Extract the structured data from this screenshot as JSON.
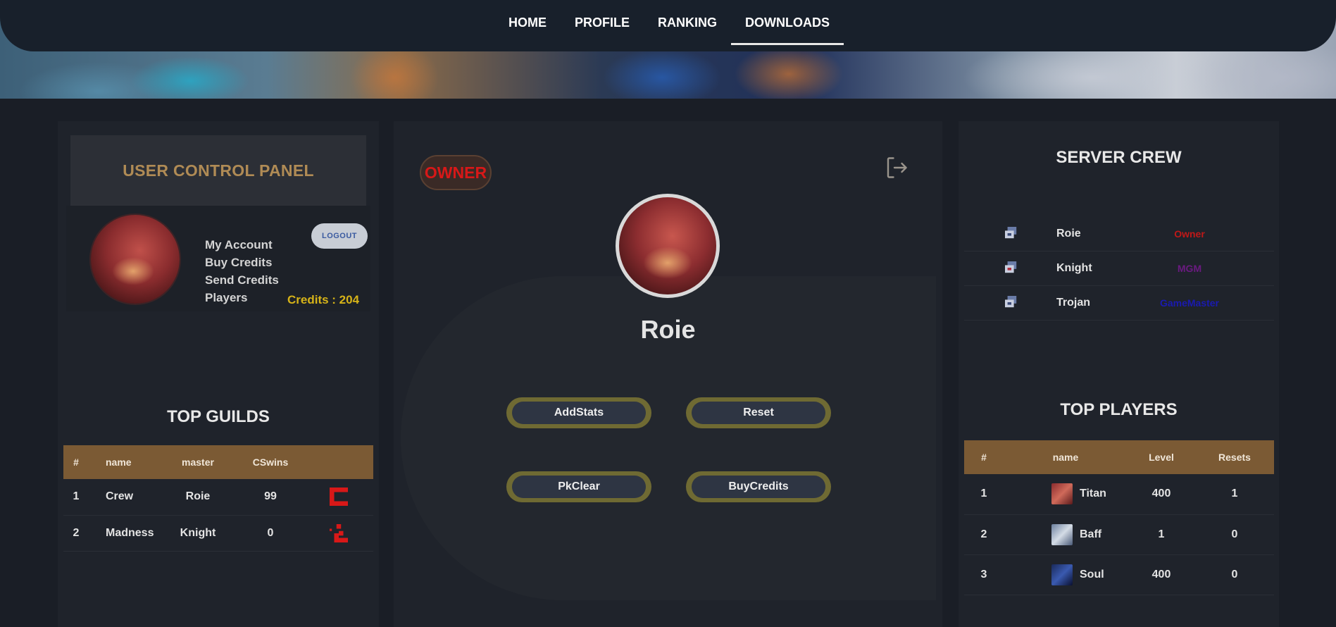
{
  "nav": {
    "items": [
      {
        "label": "HOME",
        "active": false
      },
      {
        "label": "PROFILE",
        "active": false
      },
      {
        "label": "RANKING",
        "active": false
      },
      {
        "label": "DOWNLOADS",
        "active": true
      }
    ]
  },
  "ucp": {
    "title": "USER CONTROL PANEL",
    "links": [
      "My Account",
      "Buy Credits",
      "Send Credits",
      "Players"
    ],
    "logout_label": "LOGOUT",
    "credits": "Credits : 204"
  },
  "guilds": {
    "title": "TOP GUILDS",
    "columns": [
      "#",
      "name",
      "master",
      "CSwins",
      ""
    ],
    "rows": [
      {
        "rank": "1",
        "name": "Crew",
        "master": "Roie",
        "cswins": "99"
      },
      {
        "rank": "2",
        "name": "Madness",
        "master": "Knight",
        "cswins": "0"
      }
    ]
  },
  "profile": {
    "badge": "OWNER",
    "name": "Roie",
    "buttons": [
      "AddStats",
      "Reset",
      "PkClear",
      "BuyCredits"
    ]
  },
  "crew": {
    "title": "SERVER CREW",
    "members": [
      {
        "name": "Roie",
        "role": "Owner",
        "role_color": "#c01818"
      },
      {
        "name": "Knight",
        "role": "MGM",
        "role_color": "#6a1a80"
      },
      {
        "name": "Trojan",
        "role": "GameMaster",
        "role_color": "#1a1ab0"
      }
    ]
  },
  "players": {
    "title": "TOP PLAYERS",
    "columns": [
      "#",
      "name",
      "Level",
      "Resets"
    ],
    "rows": [
      {
        "rank": "1",
        "name": "Titan",
        "level": "400",
        "resets": "1"
      },
      {
        "rank": "2",
        "name": "Baff",
        "level": "1",
        "resets": "0"
      },
      {
        "rank": "3",
        "name": "Soul",
        "level": "400",
        "resets": "0"
      }
    ]
  },
  "colors": {
    "accent_gold": "#b08b55",
    "credits": "#d6b318",
    "table_header": "#7b5a34",
    "owner_red": "#d81818"
  }
}
